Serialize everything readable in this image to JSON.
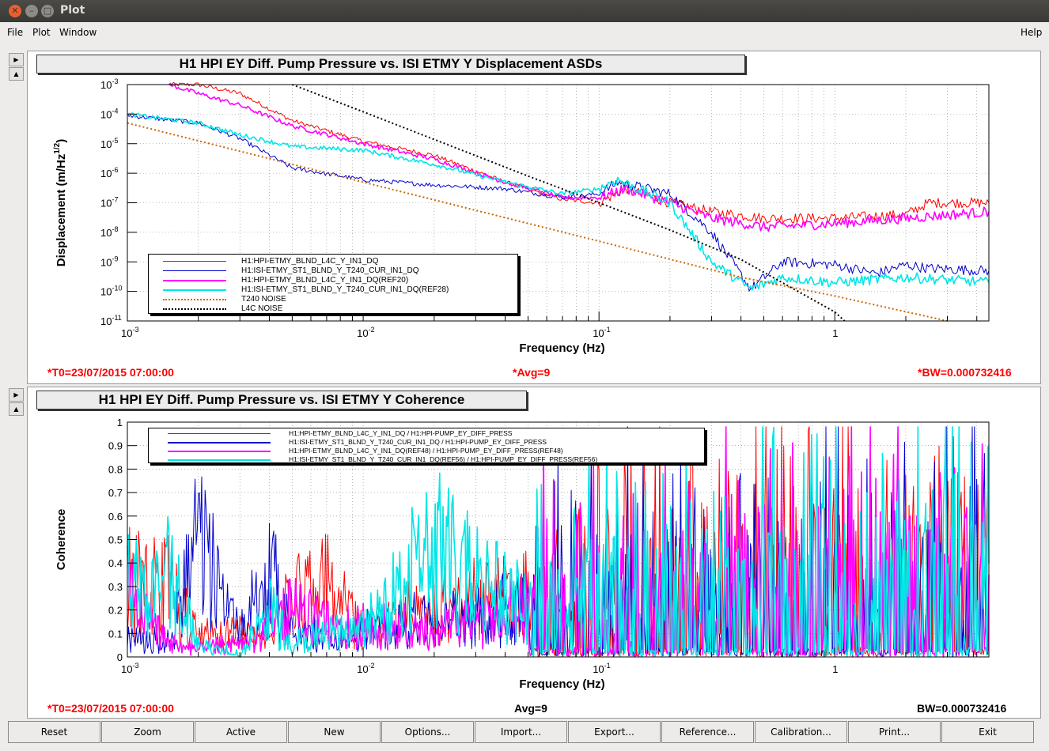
{
  "window": {
    "title": "Plot"
  },
  "menu": {
    "file": "File",
    "plot": "Plot",
    "window": "Window",
    "help": "Help"
  },
  "side": {
    "arrow": "▶",
    "up": "▲"
  },
  "top_plot": {
    "title": "H1 HPI EY Diff. Pump Pressure vs. ISI ETMY Y Displacement ASDs",
    "t0": "*T0=23/07/2015 07:00:00",
    "avg": "*Avg=9",
    "bw": "*BW=0.000732416",
    "legend": [
      "H1:HPI-ETMY_BLND_L4C_Y_IN1_DQ",
      "H1:ISI-ETMY_ST1_BLND_Y_T240_CUR_IN1_DQ",
      "H1:HPI-ETMY_BLND_L4C_Y_IN1_DQ(REF20)",
      "H1:ISI-ETMY_ST1_BLND_Y_T240_CUR_IN1_DQ(REF28)",
      "T240 NOISE",
      "L4C NOISE"
    ]
  },
  "bottom_plot": {
    "title": "H1 HPI EY Diff. Pump Pressure vs. ISI ETMY Y Coherence",
    "t0": "*T0=23/07/2015 07:00:00",
    "avg": "Avg=9",
    "bw": "BW=0.000732416",
    "legend": [
      "H1:HPI-ETMY_BLND_L4C_Y_IN1_DQ / H1:HPI-PUMP_EY_DIFF_PRESS",
      "H1:ISI-ETMY_ST1_BLND_Y_T240_CUR_IN1_DQ / H1:HPI-PUMP_EY_DIFF_PRESS",
      "H1:HPI-ETMY_BLND_L4C_Y_IN1_DQ(REF48) / H1:HPI-PUMP_EY_DIFF_PRESS(REF48)",
      "H1:ISI-ETMY_ST1_BLND_Y_T240_CUR_IN1_DQ(REF56) / H1:HPI-PUMP_EY_DIFF_PRESS(REF56)"
    ]
  },
  "toolbar": [
    "Reset",
    "Zoom",
    "Active",
    "New",
    "Options...",
    "Import...",
    "Export...",
    "Reference...",
    "Calibration...",
    "Print...",
    "Exit"
  ],
  "colors": {
    "red": "#ff0000",
    "blue": "#0000cc",
    "magenta": "#ff00ff",
    "cyan": "#00e6e6",
    "orange": "#cc6600",
    "black": "#000000"
  },
  "chart_data": [
    {
      "type": "line",
      "xlabel": "Frequency (Hz)",
      "ylabel": "Displacement (m/Hz^(1/2))",
      "x_scale": "log",
      "y_scale": "log",
      "xlim": [
        0.001,
        4.5
      ],
      "ylim": [
        1e-11,
        0.001
      ],
      "x_ticks": [
        "10^-3",
        "10^-2",
        "10^-1",
        "1"
      ],
      "y_ticks": [
        "10^-3",
        "10^-4",
        "10^-5",
        "10^-6",
        "10^-7",
        "10^-8",
        "10^-9",
        "10^-10",
        "10^-11"
      ],
      "grid": true,
      "legend_position": "bottom-left",
      "series": [
        {
          "name": "H1:HPI-ETMY_BLND_L4C_Y_IN1_DQ",
          "color": "red",
          "x": [
            0.0015,
            0.002,
            0.003,
            0.005,
            0.01,
            0.02,
            0.04,
            0.07,
            0.1,
            0.13,
            0.2,
            0.3,
            0.5,
            1,
            2,
            2.5,
            4.5
          ],
          "y": [
            0.001,
            0.001,
            0.0005,
            6e-05,
            1.2e-05,
            4e-06,
            5e-07,
            1.3e-07,
            1e-07,
            3e-07,
            1e-07,
            5e-08,
            3e-08,
            3e-08,
            4e-08,
            1e-07,
            1e-07
          ]
        },
        {
          "name": "H1:ISI-ETMY_ST1_BLND_Y_T240_CUR_IN1_DQ",
          "color": "blue",
          "x": [
            0.001,
            0.002,
            0.003,
            0.005,
            0.01,
            0.02,
            0.04,
            0.07,
            0.1,
            0.12,
            0.2,
            0.3,
            0.44,
            0.6,
            1,
            1.5,
            2,
            2.5,
            4.5
          ],
          "y": [
            9e-05,
            5e-05,
            1.5e-05,
            1.5e-06,
            6e-07,
            4e-07,
            3e-07,
            1.5e-07,
            2e-07,
            5e-07,
            2e-07,
            1e-08,
            1.2e-10,
            1e-09,
            8e-10,
            4e-10,
            8e-10,
            6e-10,
            5e-10
          ]
        },
        {
          "name": "H1:HPI-ETMY_BLND_L4C_Y_IN1_DQ(REF20)",
          "color": "magenta",
          "x": [
            0.0015,
            0.002,
            0.003,
            0.005,
            0.01,
            0.02,
            0.04,
            0.07,
            0.1,
            0.13,
            0.2,
            0.3,
            0.5,
            1,
            2,
            4.5
          ],
          "y": [
            0.001,
            0.0005,
            0.0002,
            4e-05,
            1e-05,
            3e-06,
            5e-07,
            1.5e-07,
            1.5e-07,
            3e-07,
            1e-07,
            3e-08,
            1.5e-08,
            2e-08,
            3e-08,
            5e-08
          ]
        },
        {
          "name": "H1:ISI-ETMY_ST1_BLND_Y_T240_CUR_IN1_DQ(REF28)",
          "color": "cyan",
          "x": [
            0.001,
            0.002,
            0.003,
            0.005,
            0.01,
            0.02,
            0.04,
            0.07,
            0.1,
            0.12,
            0.2,
            0.3,
            0.44,
            0.6,
            1,
            2,
            4.5
          ],
          "y": [
            0.0001,
            5e-05,
            2e-05,
            8e-06,
            6e-06,
            2e-06,
            5e-07,
            2e-07,
            3e-07,
            6e-07,
            1e-07,
            1e-09,
            1.2e-10,
            3e-10,
            2e-10,
            3e-10,
            2e-10
          ]
        },
        {
          "name": "T240 NOISE",
          "color": "orange",
          "style": "dotted",
          "x": [
            0.001,
            0.01,
            0.1,
            0.4,
            1,
            3
          ],
          "y": [
            5e-05,
            5e-07,
            5e-09,
            3e-10,
            7e-11,
            1e-11
          ]
        },
        {
          "name": "L4C NOISE",
          "color": "black",
          "style": "dotted",
          "x": [
            0.005,
            0.01,
            0.05,
            0.1,
            0.2,
            0.4,
            1,
            1.1
          ],
          "y": [
            0.001,
            0.00012,
            8e-07,
            1e-07,
            1.2e-08,
            1.2e-09,
            2e-11,
            1e-11
          ]
        }
      ]
    },
    {
      "type": "line",
      "xlabel": "Frequency (Hz)",
      "ylabel": "Coherence",
      "x_scale": "log",
      "xlim": [
        0.001,
        4.5
      ],
      "ylim": [
        0,
        1
      ],
      "x_ticks": [
        "10^-3",
        "10^-2",
        "10^-1",
        "1"
      ],
      "y_ticks": [
        "0",
        "0.1",
        "0.2",
        "0.3",
        "0.4",
        "0.5",
        "0.6",
        "0.7",
        "0.8",
        "0.9",
        "1"
      ],
      "grid": true,
      "legend_position": "top-left",
      "series": [
        {
          "name": "H1:HPI-ETMY_BLND_L4C_Y_IN1_DQ / H1:HPI-PUMP_EY_DIFF_PRESS",
          "color": "red",
          "x": [
            0.001,
            0.0015,
            0.002,
            0.003,
            0.004,
            0.005,
            0.007,
            0.01,
            0.02,
            0.05,
            0.1,
            0.3,
            1,
            4.5
          ],
          "y": [
            0.3,
            0.3,
            0.07,
            0.1,
            0.05,
            0.25,
            0.3,
            0.1,
            0.2,
            0.25,
            0.3,
            0.35,
            0.4,
            0.45
          ]
        },
        {
          "name": "H1:ISI-ETMY_ST1_BLND_Y_T240_CUR_IN1_DQ / H1:HPI-PUMP_EY_DIFF_PRESS",
          "color": "blue",
          "x": [
            0.001,
            0.0015,
            0.002,
            0.003,
            0.004,
            0.005,
            0.008,
            0.01,
            0.02,
            0.05,
            0.1,
            0.3,
            1,
            4.5
          ],
          "y": [
            0.08,
            0.05,
            0.47,
            0.1,
            0.35,
            0.1,
            0.05,
            0.1,
            0.15,
            0.2,
            0.25,
            0.3,
            0.3,
            0.35
          ]
        },
        {
          "name": "H1:HPI-ETMY_BLND_L4C_Y_IN1_DQ(REF48) / H1:HPI-PUMP_EY_DIFF_PRESS(REF48)",
          "color": "magenta",
          "x": [
            0.001,
            0.0015,
            0.002,
            0.003,
            0.004,
            0.005,
            0.008,
            0.01,
            0.02,
            0.05,
            0.1,
            0.3,
            1,
            4.5
          ],
          "y": [
            0.28,
            0.05,
            0.02,
            0.05,
            0.1,
            0.2,
            0.1,
            0.12,
            0.1,
            0.2,
            0.25,
            0.3,
            0.35,
            0.35
          ]
        },
        {
          "name": "H1:ISI-ETMY_ST1_BLND_Y_T240_CUR_IN1_DQ(REF56) / H1:HPI-PUMP_EY_DIFF_PRESS(REF56)",
          "color": "cyan",
          "x": [
            0.001,
            0.0015,
            0.002,
            0.003,
            0.004,
            0.005,
            0.008,
            0.01,
            0.02,
            0.05,
            0.1,
            0.3,
            1,
            4.5
          ],
          "y": [
            0.3,
            0.34,
            0.05,
            0.0,
            0.2,
            0.05,
            0.1,
            0.1,
            0.45,
            0.2,
            0.3,
            0.3,
            0.35,
            0.4
          ]
        }
      ]
    }
  ]
}
